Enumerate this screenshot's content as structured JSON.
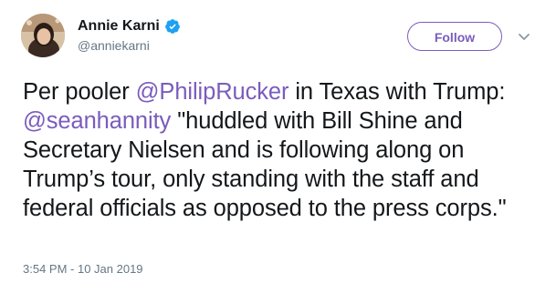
{
  "author": {
    "display_name": "Annie Karni",
    "handle": "@anniekarni",
    "verified": true,
    "avatar_icon": "avatar-photo"
  },
  "actions": {
    "follow_label": "Follow",
    "more_icon": "chevron-down-icon"
  },
  "tweet": {
    "segments": [
      {
        "type": "text",
        "text": "Per pooler "
      },
      {
        "type": "mention",
        "text": "@PhilipRucker"
      },
      {
        "type": "text",
        "text": " in Texas with Trump: "
      },
      {
        "type": "mention",
        "text": "@seanhannity"
      },
      {
        "type": "text",
        "text": " \"huddled with Bill Shine and Secretary Nielsen and is following along on Trump’s tour, only standing with the staff and federal officials as opposed to the press corps.\""
      }
    ],
    "timestamp": "3:54 PM - 10 Jan 2019"
  },
  "colors": {
    "accent": "#7b5cbd",
    "verified_badge": "#1da1f2",
    "text": "#14171a",
    "muted": "#657786"
  }
}
